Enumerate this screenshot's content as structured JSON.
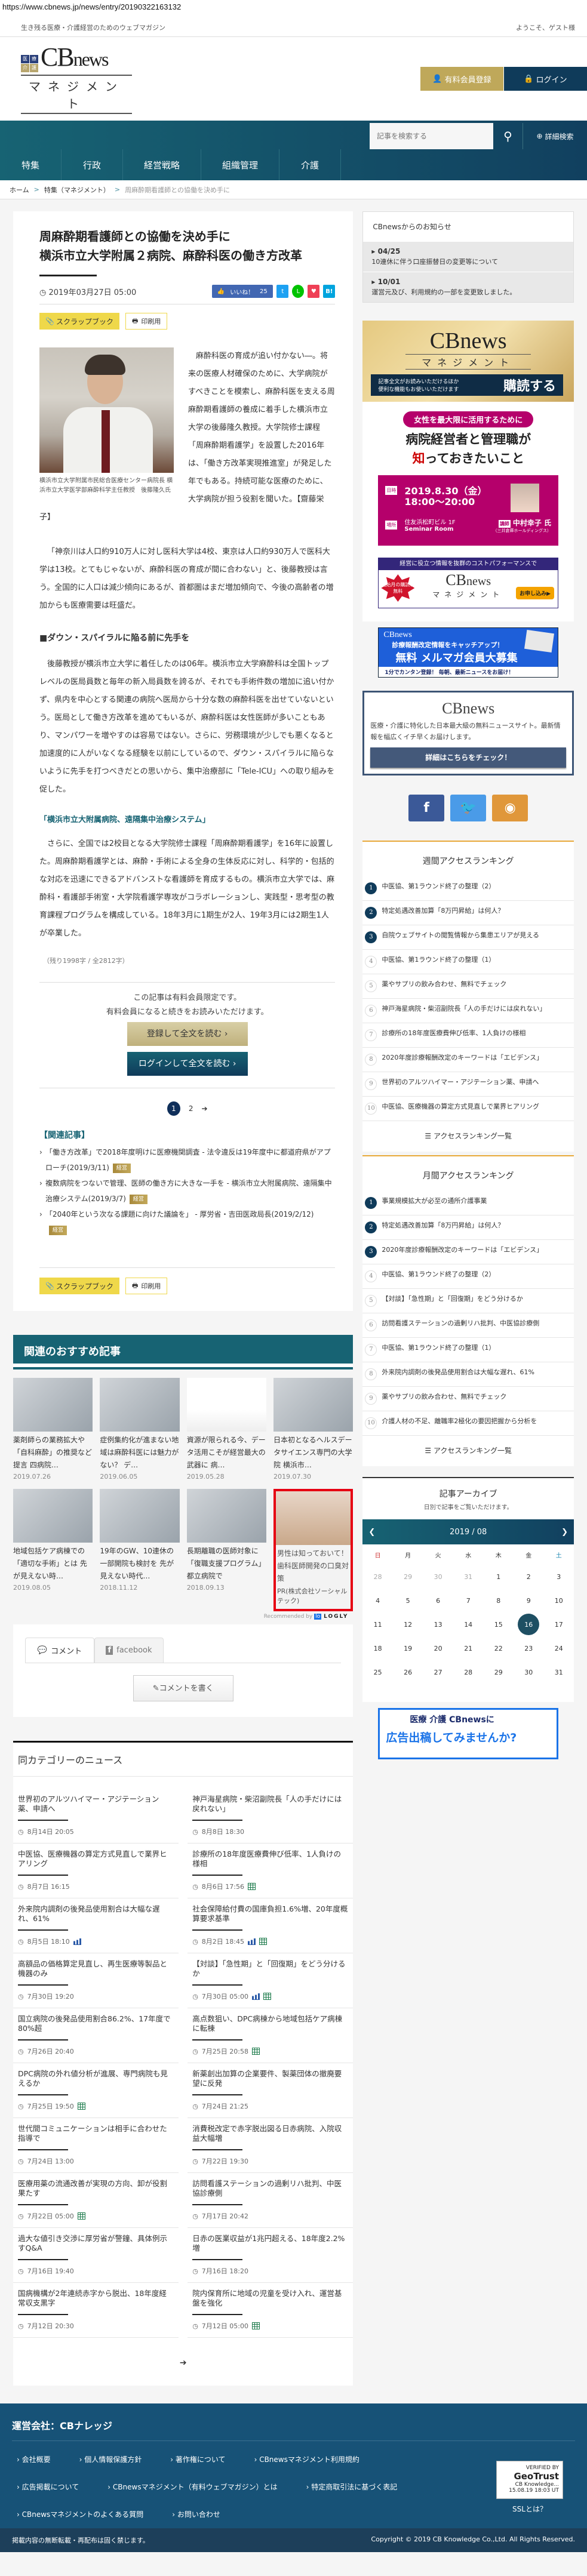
{
  "url": "https://www.cbnews.jp/news/entry/20190322163132",
  "topbar": {
    "tagline": "生き残る医療・介護経営のためのウェブマガジン",
    "welcome": "ようこそ、ゲスト様"
  },
  "logo": {
    "marks": [
      "医",
      "療",
      "介",
      "護"
    ],
    "brand": "CB",
    "brand_small": "news",
    "sub": "マネジメント"
  },
  "header": {
    "register": "有料会員登録",
    "login": "ログイン"
  },
  "search": {
    "placeholder": "記事を検索する",
    "advanced": "詳細検索"
  },
  "nav": [
    "特集",
    "行政",
    "経営戦略",
    "組織管理",
    "介護"
  ],
  "breadcrumb": {
    "home": "ホーム",
    "category": "特集（マネジメント）",
    "current": "周麻酔期看護師との協働を決め手に"
  },
  "article": {
    "title_line1": "周麻酔期看護師との協働を決め手に",
    "title_line2": "横浜市立大学附属２病院、麻酔科医の働き方改革",
    "date": "2019年03月27日 05:00",
    "like_label": "いいね！",
    "like_count": "25",
    "scrapbook": "スクラップブック",
    "print": "印刷用",
    "caption": "横浜市立大学附属市民総合医療センター病院長 横浜市立大学医学部麻酔科学主任教授　後藤隆久氏",
    "lead": "麻酔科医の育成が追い付かない―。将来の医療人材確保のために、大学病院がすべきことを模索し、麻酔科医を支える周麻酔期看護師の養成に着手した横浜市立大学の後藤隆久教授。大学院修士課程「周麻酔期看護学」を設置した2016年は、「働き方改革実現推進室」が発足した年でもある。持続可能な医療のために、大学病院が担う役割を聞いた。【齋藤栄子】",
    "p2": "「神奈川は人口約910万人に対し医科大学は4校、東京は人口約930万人で医科大学は13校。とてもじゃないが、麻酔科医の育成が間に合わない」と、後藤教授は言う。全国的に人口は減少傾向にあるが、首都圏はまだ増加傾向で、今後の高齢者の増加からも医療需要は旺盛だ。",
    "subhead": "■ダウン・スパイラルに陥る前に先手を",
    "p3": "後藤教授が横浜市立大学に着任したのは06年。横浜市立大学麻酔科は全国トップレベルの医局員数と毎年の新入局員数を誇るが、それでも手術件数の増加に追い付かず、県内を中心とする関連の病院へ医局から十分な数の麻酔科医を出せていないという。医局として働き方改革を進めてもいるが、麻酔科医は女性医師が多いこともあり、マンパワーを増やすのは容易ではない。さらに、労務環境が少しでも悪くなると加速度的に人がいなくなる経験を以前にしているので、ダウン・スパイラルに陥らないように先手を打つべきだとの思いから、集中治療部に「Tele-ICU」への取り組みを促した。",
    "related_link": "「横浜市立大附属病院、遠隔集中治療システム」",
    "p4": "さらに、全国では2校目となる大学院修士課程「周麻酔期看護学」を16年に設置した。周麻酔期看護学とは、麻酔・手術による全身の生体反応に対し、科学的・包括的な対応を迅速にできるアドバンストな看護師を育成するもの。横浜市立大学では、麻酔科・看護部手術室・大学院看護学専攻がコラボレーションし、実践型・思考型の教育課程プログラムを構成している。18年3月に1期生が2人、19年3月には2期生1人が卒業した。",
    "remaining": "（残り1998字 / 全2812字）",
    "paywall_line1": "この記事は有料会員限定です。",
    "paywall_line2": "有料会員になると続きをお読みいただけます。",
    "register_read": "登録して全文を読む ›",
    "login_read": "ログインして全文を読む ›",
    "pages": [
      "1",
      "2"
    ],
    "next": "➔",
    "related_heading": "【関連記事】",
    "related": [
      {
        "title": "「働き方改革」で2018年度明けに医療機関調査 - 法令違反は19年度中に都道府県がアプローチ(2019/3/11)",
        "badge": "経営"
      },
      {
        "title": "複数病院をつないで管理、医師の働き方に大きな一手を - 横浜市立大附属病院、遠隔集中治療システム(2019/3/7)",
        "badge": "経営"
      },
      {
        "title": "「2040年という次なる課題に向けた議論を」 - 厚労省・吉田医政局長(2019/2/12)",
        "badge": "経営"
      }
    ]
  },
  "recommended": {
    "heading": "関連のおすすめ記事",
    "items": [
      {
        "title": "薬剤師らの業務拡大や「自科麻酔」の推奨など提言 四病院…",
        "date": "2019.07.26"
      },
      {
        "title": "症例集約化が進まない地域は麻酔科医には魅力がない？ デ…",
        "date": "2019.06.05"
      },
      {
        "title": "資源が限られる今、データ活用こそが経営最大の武器に 病…",
        "date": "2019.05.28"
      },
      {
        "title": "日本初となるヘルスデータサイエンス専門の大学院 横浜市…",
        "date": "2019.07.30"
      },
      {
        "title": "地域包括ケア病棟での「適切な手術」とは 先が見えない時…",
        "date": "2019.08.05"
      },
      {
        "title": "19年のGW、10連休の一部開院も検討を 先が見えない時代…",
        "date": "2018.11.12"
      },
      {
        "title": "長期離職の医師対象に「復職支援プログラム」 都立病院で",
        "date": "2018.09.13"
      },
      {
        "title": "男性は知っておいて！歯科医師開発の口臭対策",
        "date": "PR(株式会社ソーシャルテック)"
      }
    ],
    "recommended_by": "Recommended by",
    "logly": "LOGLY"
  },
  "comments": {
    "tab_comment": "コメント",
    "tab_facebook": "facebook",
    "write": "コメントを書く"
  },
  "same_category": {
    "heading": "同カテゴリーのニュース",
    "items": [
      {
        "title": "世界初のアルツハイマー・アジテーション薬、申請へ",
        "date": "8月14日 20:05",
        "icons": []
      },
      {
        "title": "神戸海星病院・柴沼副院長「人の手だけには戻れない」",
        "date": "8月8日 18:30",
        "icons": []
      },
      {
        "title": "中医協、医療機器の算定方式見直しで業界ヒアリング",
        "date": "8月7日 16:15",
        "icons": []
      },
      {
        "title": "診療所の18年度医療費伸び低率、1人負けの様相",
        "date": "8月6日 17:56",
        "icons": [
          "table"
        ]
      },
      {
        "title": "外来院内調剤の後発品使用割合は大幅な遅れ、61%",
        "date": "8月5日 18:10",
        "icons": [
          "chart"
        ]
      },
      {
        "title": "社会保障給付費の国庫負担1.6%増、20年度概算要求基準",
        "date": "8月2日 18:45",
        "icons": [
          "chart",
          "table"
        ]
      },
      {
        "title": "高額品の価格算定見直し、再生医療等製品と機器のみ",
        "date": "7月30日 19:20",
        "icons": []
      },
      {
        "title": "【対談】「急性期」と「回復期」をどう分けるか",
        "date": "7月30日 05:00",
        "icons": [
          "chart",
          "table"
        ]
      },
      {
        "title": "国立病院の後発品使用割合86.2%、17年度で80%超",
        "date": "7月26日 20:40",
        "icons": []
      },
      {
        "title": "高点数狙い、DPC病棟から地域包括ケア病棟に転棟",
        "date": "7月25日 20:58",
        "icons": [
          "table"
        ]
      },
      {
        "title": "DPC病院の外れ値分析が進展、専門病院も見えるか",
        "date": "7月25日 19:50",
        "icons": [
          "table"
        ]
      },
      {
        "title": "新薬創出加算の企業要件、製薬団体の撤廃要望に反発",
        "date": "7月24日 21:25",
        "icons": []
      },
      {
        "title": "世代間コミュニケーションは相手に合わせた指導で",
        "date": "7月24日 13:00",
        "icons": []
      },
      {
        "title": "消費税改定で赤字脱出図る日赤病院、入院収益大幅増",
        "date": "7月22日 19:30",
        "icons": []
      },
      {
        "title": "医療用薬の流通改善が実現の方向、卸が役割果たす",
        "date": "7月22日 05:00",
        "icons": [
          "table"
        ]
      },
      {
        "title": "訪問看護ステーションの過剰リハ批判、中医協診療側",
        "date": "7月17日 20:42",
        "icons": []
      },
      {
        "title": "過大な値引き交渉に厚労省が警鐘、具体例示すQ&A",
        "date": "7月16日 19:40",
        "icons": []
      },
      {
        "title": "日赤の医業収益が1兆円超える、18年度2.2%増",
        "date": "7月16日 18:20",
        "icons": []
      },
      {
        "title": "国病機構が2年連続赤字から脱出、18年度経常収支黒字",
        "date": "7月12日 20:30",
        "icons": []
      },
      {
        "title": "院内保育所に地域の児童を受け入れ、運営基盤を強化",
        "date": "7月12日 05:00",
        "icons": [
          "table"
        ]
      }
    ],
    "next": "➔"
  },
  "sidebar": {
    "notice_heading": "CBnewsからのお知らせ",
    "notices": [
      {
        "date": "04/25",
        "text": "10連休に伴う口座振替日の変更等について"
      },
      {
        "date": "10/01",
        "text": "運営元及び、利用規約の一部を変更致しました。"
      }
    ],
    "subscribe": {
      "line1": "記事全文がお読みいただけるほか",
      "line2": "便利な機能もお使いいただけます",
      "cta": "購読する"
    },
    "seminar": {
      "pill": "女性を最大限に活用するために",
      "head1": "病院経営者と管理職が",
      "head_red": "知",
      "head2": "っておきたいこと",
      "date": "2019.8.30（金）",
      "time": "18:00～20:00",
      "place1": "住友浜松町ビル 1F",
      "place2": "Seminar Room",
      "speaker": "中村幸子 氏",
      "speaker_org": "（三井倉庫ホールディングス）",
      "date_label": "日時",
      "place_label": "場所",
      "speaker_label": "講師"
    },
    "cb_ad": {
      "top": "経営に役立つ情報を抜群のコストパフォーマンスで",
      "star": "開始月の購読料無料",
      "apply": "お申し込み▶"
    },
    "mail_ad": {
      "brand": "CBnews",
      "line1": "診療報酬改定情報をキャッチアップ！",
      "line2": "無料 メルマガ会員大募集",
      "line3": "1分でカンタン登録！ 毎朝、最新ニュースをお届け！"
    },
    "cb_box": {
      "brand": "CBnews",
      "desc": "医療・介護に特化した日本最大級の無料ニュースサイト。最新情報を幅広くイチ早くお届けします。",
      "button": "詳細はこちらをチェック！"
    },
    "social": {
      "facebook": "f",
      "twitter": "t",
      "rss": "rss"
    },
    "weekly": {
      "heading": "週間アクセスランキング",
      "items": [
        "中医協、第1ラウンド終了の整理（2）",
        "特定処遇改善加算「8万円昇給」は何人？",
        "自院ウェブサイトの閲覧情報から集患エリアが見える",
        "中医協、第1ラウンド終了の整理（1）",
        "薬やサプリの飲み合わせ、無料でチェック",
        "神戸海星病院・柴沼副院長「人の手だけには戻れない」",
        "診療所の18年度医療費伸び低率、1人負けの様相",
        "2020年度診療報酬改定のキーワードは「エビデンス」",
        "世界初のアルツハイマー・アジテーション薬、申請へ",
        "中医協、医療機器の算定方式見直しで業界ヒアリング"
      ],
      "more": "アクセスランキング一覧"
    },
    "monthly": {
      "heading": "月間アクセスランキング",
      "items": [
        "事業規模拡大が必至の通所介護事業",
        "特定処遇改善加算「8万円昇給」は何人？",
        "2020年度診療報酬改定のキーワードは「エビデンス」",
        "中医協、第1ラウンド終了の整理（2）",
        "【対談】「急性期」と「回復期」をどう分けるか",
        "訪問看護ステーションの過剰リハ批判、中医協診療側",
        "中医協、第1ラウンド終了の整理（1）",
        "外来院内調剤の後発品使用割合は大幅な遅れ、61%",
        "薬やサプリの飲み合わせ、無料でチェック",
        "介護人材の不足、離職率2極化の要因把握から分析を"
      ],
      "more": "アクセスランキング一覧"
    },
    "archive": {
      "heading": "記事アーカイブ",
      "sub": "日別で記事をご覧いただけます。",
      "month": "2019 / 08",
      "weekdays": [
        "日",
        "月",
        "火",
        "水",
        "木",
        "金",
        "土"
      ],
      "days": [
        "28",
        "29",
        "30",
        "31",
        "1",
        "2",
        "3",
        "4",
        "5",
        "6",
        "7",
        "8",
        "9",
        "10",
        "11",
        "12",
        "13",
        "14",
        "15",
        "16",
        "17",
        "18",
        "19",
        "20",
        "21",
        "22",
        "23",
        "24",
        "25",
        "26",
        "27",
        "28",
        "29",
        "30",
        "31"
      ],
      "selected": "16"
    },
    "ad": {
      "line1": "医療 介護 CBnewsに",
      "line2": "広告出稿してみませんか?"
    }
  },
  "footer": {
    "company": "運営会社：CBナレッジ",
    "links": [
      "会社概要",
      "個人情報保護方針",
      "著作権について",
      "CBnewsマネジメント利用規約",
      "広告掲載について",
      "CBnewsマネジメント（有料ウェブマガジン）とは",
      "特定商取引法に基づく表記",
      "CBnewsマネジメントのよくある質問",
      "お問い合わせ"
    ],
    "ssl_verified": "VERIFIED BY",
    "ssl_brand": "GeoTrust",
    "ssl_org": "CB Knowledge...",
    "ssl_date": "15.08.19 18:03 UT",
    "ssl_label": "SSLとは？",
    "notice": "掲載内容の無断転載・再配布は固く禁じます。",
    "copyright": "Copyright © 2019 CB Knowledge Co.,Ltd. All Rights Reserved."
  },
  "colors": {
    "teal": "#176373",
    "navy": "#0f3b5a",
    "gold": "#bfa85a",
    "scrap_yellow": "#efd84a",
    "footer": "#175277"
  }
}
